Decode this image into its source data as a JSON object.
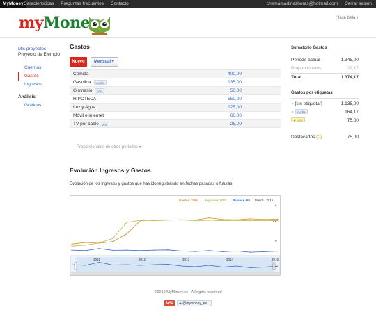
{
  "topbar": {
    "brand": "MyMoney",
    "nav": [
      "Características",
      "Preguntas frecuentes",
      "Contacto"
    ],
    "email": "chemamartinezheras@hotmail.com",
    "logout": "Cerrar sesión"
  },
  "header": {
    "logo_my": "my",
    "logo_money": "Money",
    "beta": "( fase beta )"
  },
  "sidebar": {
    "projects_link": "Mis proyectos",
    "project_name": "Proyecto de Ejemplo",
    "items": [
      "Cuentas",
      "Gastos",
      "Ingresos"
    ],
    "analysis_head": "Análisis",
    "analysis_items": [
      "Gráficos"
    ]
  },
  "main": {
    "title": "Gastos",
    "new_button": "Nuevo",
    "period_select": "Mensual",
    "rows": [
      {
        "name": "Comida",
        "tag": "",
        "value": "400,00"
      },
      {
        "name": "Gasolina",
        "tag": "coche",
        "value": "135,00"
      },
      {
        "name": "Gimnasio",
        "tag": "ocio",
        "value": "50,00"
      },
      {
        "name": "HIPOTECA",
        "tag": "",
        "value": "550,00"
      },
      {
        "name": "Luz y Agua",
        "tag": "",
        "value": "125,00"
      },
      {
        "name": "Móvil e internet",
        "tag": "",
        "value": "60,00"
      },
      {
        "name": "TV por cable",
        "tag": "ocio",
        "value": "25,00"
      }
    ],
    "proportional_link": "Proporcionales de otros periodos ▾"
  },
  "summary": {
    "title": "Sumatorio Gastos",
    "current_label": "Periodo actual",
    "current_value": "1.345,00",
    "prop_label": "Proporcionales",
    "prop_value": "29,17",
    "total_label": "Total",
    "total_value": "1.374,17",
    "tags_title": "Gastos por etiquetas",
    "tags": [
      {
        "label": "[sin etiquetar]",
        "value": "1.135,00"
      },
      {
        "label": "coche",
        "value": "164,17"
      },
      {
        "label": "ocio",
        "value": "75,00"
      }
    ],
    "featured_label": "Destacados",
    "featured_count": "(0)",
    "featured_value": "75,00"
  },
  "evolution": {
    "title": "Evolución Ingresos y Gastos",
    "description": "Evolución de los ingresos y gastos que has ido registrando en fechas pasadas o futuras",
    "legend": {
      "gastos": "Gastos 1345",
      "ingresos": "Ingresos 1280",
      "balance": "Balance -65",
      "date": "March , 2015"
    },
    "y_ticks": [
      "2",
      "1 k",
      "0"
    ],
    "nav_years": [
      "2011",
      "2012",
      "2013",
      "2014",
      "2015"
    ]
  },
  "chart_data": {
    "type": "line",
    "x": [
      "2010-06",
      "2011-01",
      "2011-06",
      "2011-10",
      "2012-01",
      "2012-03",
      "2012-06",
      "2012-10",
      "2013-01",
      "2013-06",
      "2013-09",
      "2014-01",
      "2014-06",
      "2014-10",
      "2015-01",
      "2015-03"
    ],
    "series": [
      {
        "name": "Gastos",
        "color": "#d98a1c",
        "values": [
          250,
          320,
          290,
          360,
          700,
          1280,
          1300,
          1310,
          1320,
          1310,
          1400,
          1330,
          1320,
          1360,
          1330,
          1345
        ]
      },
      {
        "name": "Ingresos",
        "color": "#b7b94a",
        "values": [
          160,
          200,
          300,
          500,
          1200,
          1300,
          1280,
          1300,
          1320,
          1280,
          1300,
          1280,
          1290,
          1280,
          1280,
          1280
        ]
      },
      {
        "name": "Balance",
        "color": "#3366cc",
        "values": [
          -20,
          -40,
          50,
          -30,
          -20,
          -40,
          -20,
          -10,
          -60,
          -80,
          -40,
          -90,
          -60,
          -110,
          -90,
          -65
        ]
      }
    ],
    "ylim": [
      -200,
      2000
    ]
  },
  "footer": {
    "copyright": "©2012 MyMoney.es - All rights reserved",
    "gplus": "G+1",
    "twitter": "@mymoney_es"
  }
}
